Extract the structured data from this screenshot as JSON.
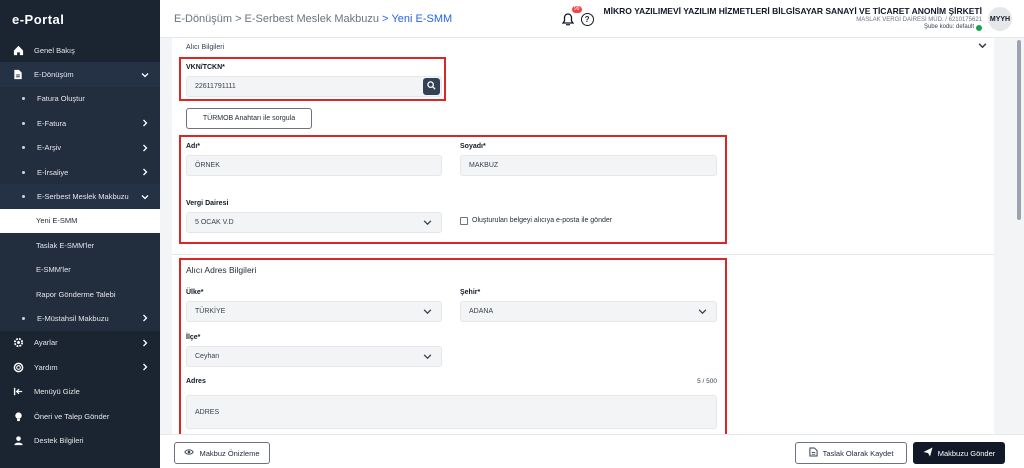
{
  "app": {
    "logo": "e-Portal"
  },
  "sidebar": {
    "items": [
      {
        "label": "Genel Bakış"
      },
      {
        "label": "E-Dönüşüm"
      },
      {
        "label": "Fatura Oluştur"
      },
      {
        "label": "E-Fatura"
      },
      {
        "label": "E-Arşiv"
      },
      {
        "label": "E-İrsaliye"
      },
      {
        "label": "E-Serbest Meslek Makbuzu"
      },
      {
        "label": "Yeni E-SMM"
      },
      {
        "label": "Taslak E-SMM'ler"
      },
      {
        "label": "E-SMM'ler"
      },
      {
        "label": "Rapor Gönderme Talebi"
      },
      {
        "label": "E-Müstahsil Makbuzu"
      },
      {
        "label": "Ayarlar"
      },
      {
        "label": "Yardım"
      },
      {
        "label": "Menüyü Gizle"
      },
      {
        "label": "Öneri ve Talep Gönder"
      },
      {
        "label": "Destek Bilgileri"
      }
    ]
  },
  "header": {
    "breadcrumb": [
      "E-Dönüşüm",
      "E-Serbest Meslek Makbuzu",
      "Yeni E-SMM"
    ],
    "separator": ">",
    "notification_count": "99",
    "company_name": "MİKRO YAZILIMEVİ YAZILIM HİZMETLERİ BİLGİSAYAR SANAYİ VE TİCARET ANONİM ŞİRKETİ",
    "tax_office": "MASLAK VERGİ DAİRESİ MÜD. / 6210175621",
    "branch": "Şube kodu: default",
    "avatar": "MYYH"
  },
  "form": {
    "section_title": "Alıcı Bilgileri",
    "vkn_label": "VKN/TCKN*",
    "vkn_value": "22611791111",
    "turmob_button": "TÜRMOB Anahtarı ile sorgula",
    "name_label": "Adı*",
    "name_value": "ÖRNEK",
    "surname_label": "Soyadı*",
    "surname_value": "MAKBUZ",
    "tax_office_label": "Vergi Dairesi",
    "tax_office_value": "5 OCAK V.D",
    "email_checkbox_label": "Oluşturulan belgeyi alıcıya e-posta ile gönder",
    "address_section_title": "Alıcı Adres Bilgileri",
    "country_label": "Ülke*",
    "country_value": "TÜRKİYE",
    "city_label": "Şehir*",
    "city_value": "ADANA",
    "district_label": "İlçe*",
    "district_value": "Ceyhan",
    "address_label": "Adres",
    "address_counter": "5 / 500",
    "address_value": "ADRES"
  },
  "footer": {
    "preview_button": "Makbuz Önizleme",
    "draft_button": "Taslak Olarak Kaydet",
    "send_button": "Makbuzu Gönder"
  },
  "colors": {
    "sidebar_bg": "#1b2431",
    "highlight_red": "#dc2626",
    "breadcrumb_active": "#2563eb",
    "primary_dark": "#111827"
  }
}
